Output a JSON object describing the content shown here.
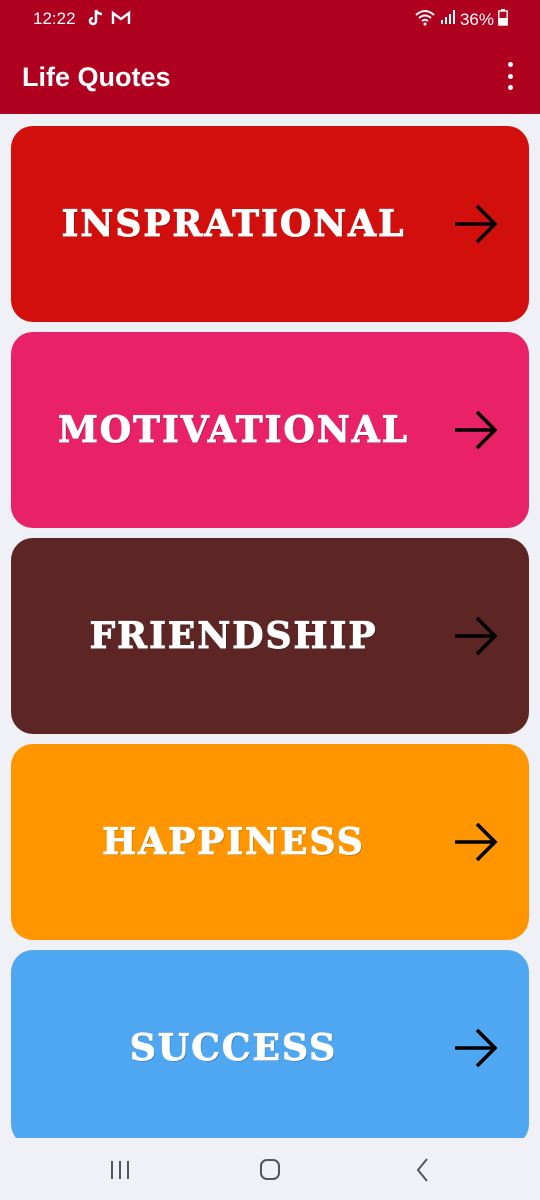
{
  "status_bar": {
    "time": "12:22",
    "left_icons": [
      "tiktok-icon",
      "gmail-icon"
    ],
    "right_icons": [
      "wifi-icon",
      "signal-icon"
    ],
    "battery_text": "36%",
    "battery_icon": "battery-icon"
  },
  "app_bar": {
    "title": "Life Quotes",
    "menu_icon": "more-vert-icon"
  },
  "categories": [
    {
      "label": "INSPRATIONAL",
      "color": "#d20f0c"
    },
    {
      "label": "MOTIVATIONAL",
      "color": "#e92166"
    },
    {
      "label": "FRIENDSHIP",
      "color": "#5e2525"
    },
    {
      "label": "HAPPINESS",
      "color": "#ff9600"
    },
    {
      "label": "SUCCESS",
      "color": "#4ea7f0"
    }
  ],
  "arrow_icon": "arrow-forward-icon",
  "nav_bar": {
    "buttons": [
      "recent-apps-icon",
      "home-icon",
      "back-icon"
    ]
  },
  "colors": {
    "app_bar": "#b00020",
    "background": "#f0f1f6"
  }
}
